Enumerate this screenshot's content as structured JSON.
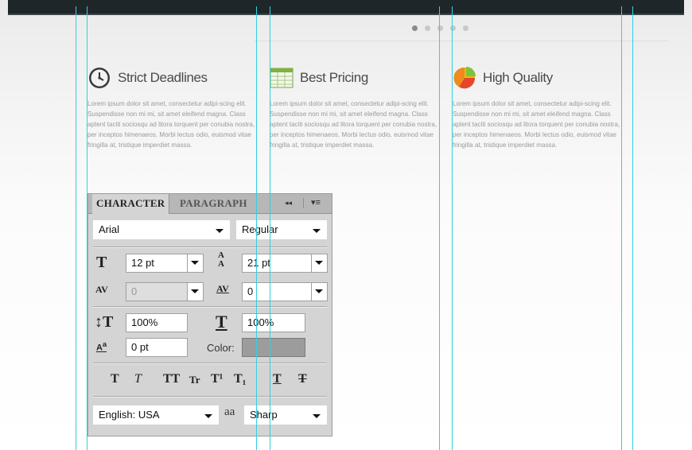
{
  "slider": {
    "dot_count": 5,
    "active_index": 0
  },
  "features": [
    {
      "title": "Strict Deadlines",
      "icon": "clock-icon",
      "body": "Lorem ipsum dolor sit amet, consectetur adipi-scing elit. Suspendisse non mi mi, sit amet eleifend magna. Class aptent taciti sociosqu ad litora torquent per conubia nostra, per inceptos himenaeos. Morbi lectus odio, euismod vitae fringilla at, tristique imperdiet massa."
    },
    {
      "title": "Best Pricing",
      "icon": "spreadsheet-icon",
      "body": "Lorem ipsum dolor sit amet, consectetur adipi-scing elit. Suspendisse non mi mi, sit amet eleifend magna. Class aptent taciti sociosqu ad litora torquent per conubia nostra, per inceptos himenaeos. Morbi lectus odio, euismod vitae fringilla at, tristique imperdiet massa."
    },
    {
      "title": "High Quality",
      "icon": "pie-chart-icon",
      "body": "Lorem ipsum dolor sit amet, consectetur adipi-scing elit. Suspendisse non mi mi, sit amet eleifend magna. Class aptent taciti sociosqu ad litora torquent per conubia nostra, per inceptos himenaeos. Morbi lectus odio, euismod vitae fringilla at, tristique imperdiet massa."
    }
  ],
  "panel": {
    "tabs": {
      "character": "CHARACTER",
      "paragraph": "PARAGRAPH",
      "collapse": "◂◂",
      "menu": "▾≡"
    },
    "font_family": "Arial",
    "font_style": "Regular",
    "font_size": "12 pt",
    "leading": "21 pt",
    "kerning": "0",
    "tracking": "0",
    "vertical_scale": "100%",
    "horizontal_scale": "100%",
    "baseline_shift": "0 pt",
    "color_label": "Color:",
    "color_value": "#9c9c9c",
    "type_styles": [
      "T",
      "T",
      "TT",
      "Tr",
      "T¹",
      "T₁",
      "T",
      "T"
    ],
    "language": "English: USA",
    "antialias_icon_text": "aa",
    "antialias": "Sharp"
  },
  "colors": {
    "guide": "#2fd1e0",
    "topbar": "#1f2629",
    "panel": "#d4d4d4"
  }
}
